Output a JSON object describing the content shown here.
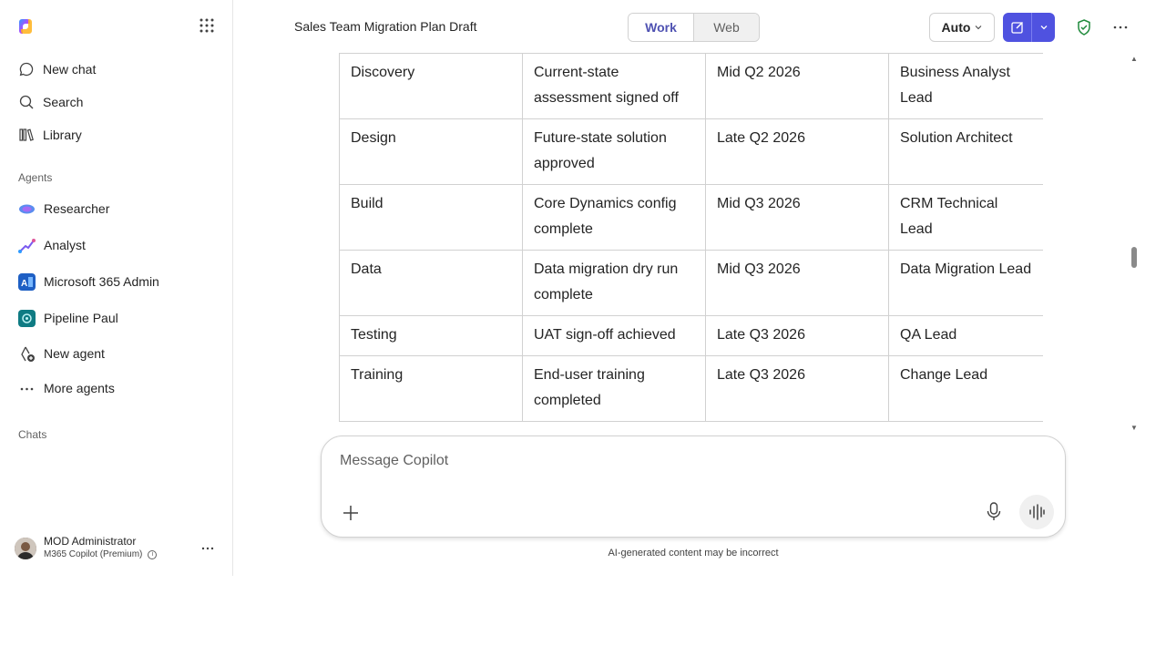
{
  "sidebar": {
    "nav": [
      {
        "label": "New chat",
        "icon": "chat-icon"
      },
      {
        "label": "Search",
        "icon": "search-icon"
      },
      {
        "label": "Library",
        "icon": "library-icon"
      }
    ],
    "agents_label": "Agents",
    "agents": [
      {
        "label": "Researcher",
        "icon": "researcher-icon"
      },
      {
        "label": "Analyst",
        "icon": "analyst-icon"
      },
      {
        "label": "Microsoft 365 Admin",
        "icon": "m365-admin-icon"
      },
      {
        "label": "Pipeline Paul",
        "icon": "pipeline-paul-icon"
      },
      {
        "label": "New agent",
        "icon": "new-agent-icon"
      },
      {
        "label": "More agents",
        "icon": "more-icon"
      }
    ],
    "chats_label": "Chats",
    "user": {
      "name": "MOD Administrator",
      "plan": "M365 Copilot (Premium)"
    }
  },
  "header": {
    "title": "Sales Team Migration Plan Draft",
    "toggle": {
      "work": "Work",
      "web": "Web",
      "selected": "Work"
    },
    "model_select": "Auto"
  },
  "table": {
    "rows": [
      [
        "",
        "",
        "",
        ""
      ],
      [
        "Discovery",
        "Current-state assessment signed off",
        "Mid Q2 2026",
        "Business Analyst Lead"
      ],
      [
        "Design",
        "Future-state solution approved",
        "Late Q2 2026",
        "Solution Architect"
      ],
      [
        "Build",
        "Core Dynamics config complete",
        "Mid Q3 2026",
        "CRM Technical Lead"
      ],
      [
        "Data",
        "Data migration dry run complete",
        "Mid Q3 2026",
        "Data Migration Lead"
      ],
      [
        "Testing",
        "UAT sign-off achieved",
        "Late Q3 2026",
        "QA Lead"
      ],
      [
        "Training",
        "End-user training completed",
        "Late Q3 2026",
        "Change Lead"
      ]
    ]
  },
  "composer": {
    "placeholder": "Message Copilot",
    "disclaimer": "AI-generated content may be incorrect"
  },
  "colors": {
    "accent": "#4f52e0",
    "brand_text": "#4f52b2",
    "shield": "#1f8a3b"
  }
}
